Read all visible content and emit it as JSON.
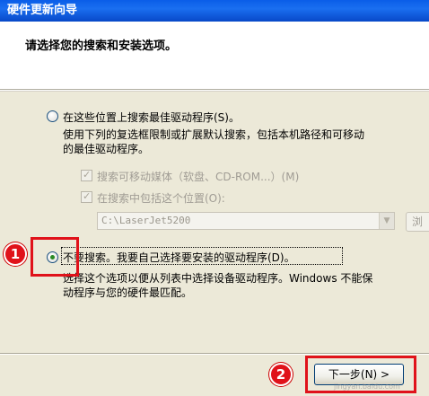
{
  "window": {
    "title": "硬件更新向导"
  },
  "header": {
    "title": "请选择您的搜索和安装选项。"
  },
  "option_search": {
    "label": "在这些位置上搜索最佳驱动程序(S)。",
    "desc_line1": "使用下列的复选框限制或扩展默认搜索，包括本机路径和可移动",
    "desc_line2": "的最佳驱动程序。",
    "selected": false
  },
  "check_removable": {
    "label": "搜索可移动媒体（软盘、CD-ROM...）(M)",
    "checked": true
  },
  "check_location": {
    "label": "在搜索中包括这个位置(O):",
    "checked": true
  },
  "path_combo": {
    "value": "C:\\LaserJet5200"
  },
  "browse_button": {
    "label": "浏"
  },
  "option_manual": {
    "label": "不要搜索。我要自己选择要安装的驱动程序(D)。",
    "desc_line1": "选择这个选项以便从列表中选择设备驱动程序。Windows 不能保",
    "desc_line2": "动程序与您的硬件最匹配。",
    "selected": true
  },
  "annotations": {
    "badge1": "1",
    "badge2": "2"
  },
  "footer": {
    "next_label": "下一步(N) >"
  },
  "watermark": "jingyan.baidu.com",
  "colors": {
    "title_bar": "#0a5de8",
    "annotation_red": "#e0121a",
    "radio_selected": "#2a8a24"
  }
}
